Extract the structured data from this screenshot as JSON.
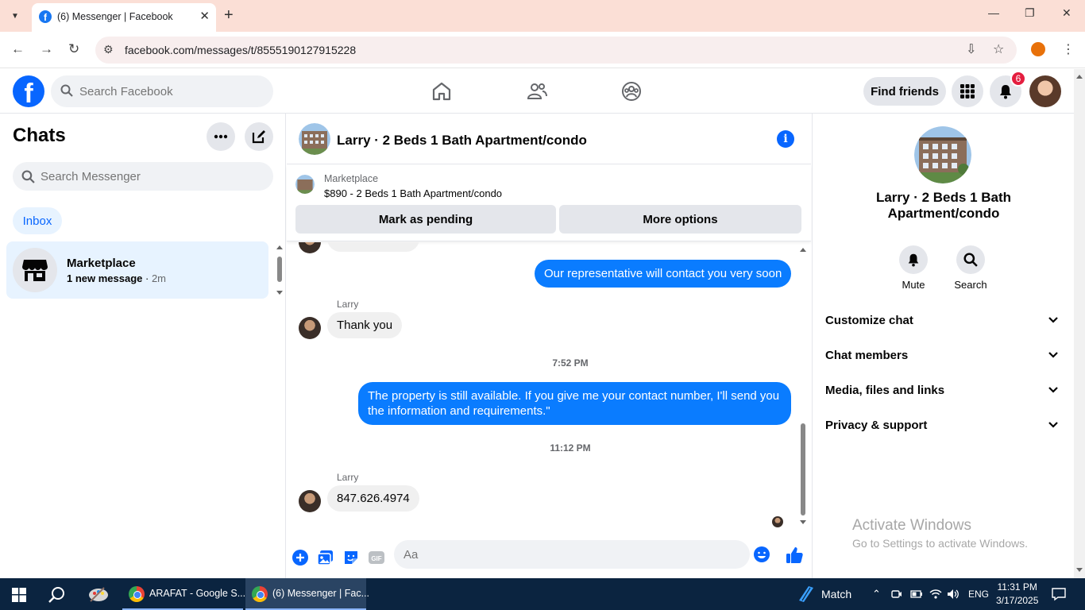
{
  "browser": {
    "tab_title": "(6) Messenger | Facebook",
    "url": "facebook.com/messages/t/8555190127915228"
  },
  "header": {
    "search_placeholder": "Search Facebook",
    "find_friends": "Find friends",
    "notification_count": "6"
  },
  "sidebar": {
    "title": "Chats",
    "search_placeholder": "Search Messenger",
    "filter": "Inbox",
    "conversations": [
      {
        "name": "Marketplace",
        "preview": "1 new message",
        "time": "2m"
      }
    ]
  },
  "chat": {
    "title": "Larry · 2 Beds 1 Bath Apartment/condo",
    "marketplace_label": "Marketplace",
    "listing": "$890 - 2 Beds 1 Bath Apartment/condo",
    "mark_pending": "Mark as pending",
    "more_options": "More options",
    "partial_message": "847.626.4974",
    "messages": [
      {
        "from": "me",
        "text": "Our representative will contact you very soon"
      },
      {
        "from": "Larry",
        "sender": "Larry",
        "text": "Thank you"
      },
      {
        "timestamp": "7:52 PM"
      },
      {
        "from": "me",
        "text": "The property is still available. If you give me your contact number, I'll send you the information and requirements.\""
      },
      {
        "timestamp": "11:12 PM"
      },
      {
        "from": "Larry",
        "sender": "Larry",
        "text": "847.626.4974"
      }
    ],
    "composer_placeholder": "Aa"
  },
  "details": {
    "name": "Larry · 2 Beds 1 Bath Apartment/condo",
    "actions": [
      "Mute",
      "Search"
    ],
    "sections": [
      "Customize chat",
      "Chat members",
      "Media, files and links",
      "Privacy & support"
    ]
  },
  "watermark": {
    "line1": "Activate Windows",
    "line2": "Go to Settings to activate Windows."
  },
  "taskbar": {
    "apps": [
      "ARAFAT - Google S...",
      "(6) Messenger | Fac..."
    ],
    "weather": "Match",
    "language": "ENG",
    "time": "11:31 PM",
    "date": "3/17/2025"
  },
  "colors": {
    "fb_blue": "#0866ff",
    "bubble_out": "#0a7cff",
    "taskbar": "#0b2440",
    "tabbar": "#fbdfd6"
  }
}
